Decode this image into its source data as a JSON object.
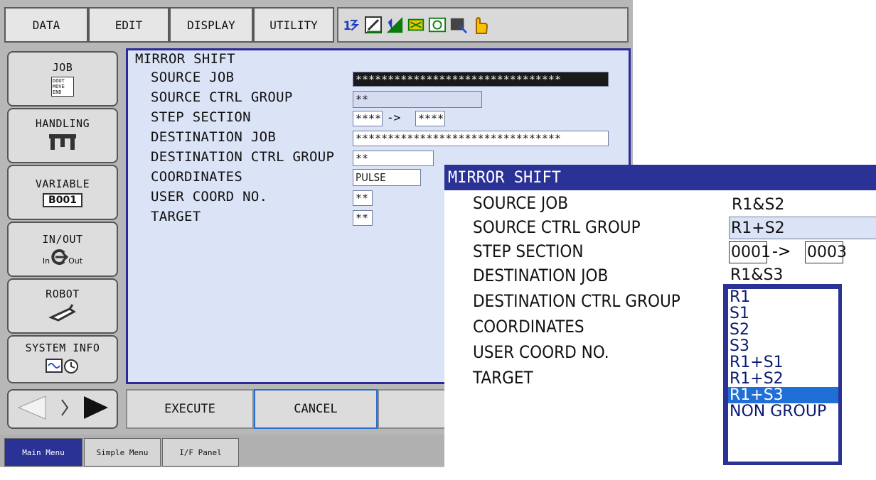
{
  "menu_bar": {
    "data": "DATA",
    "edit": "EDIT",
    "display": "DISPLAY",
    "utility": "UTILITY"
  },
  "status_icons": [
    "step-icon",
    "edit-mode-icon",
    "signal-icon",
    "tool-icon",
    "camera-icon",
    "lock-icon",
    "hand-icon"
  ],
  "side_menu": {
    "job": "JOB",
    "job_icon_text": "DOUT MOVE END",
    "handling": "HANDLING",
    "variable": "VARIABLE",
    "variable_icon_text": "B001",
    "in_out": "IN/OUT",
    "io_in": "In",
    "io_out": "Out",
    "robot": "ROBOT",
    "system_info": "SYSTEM INFO"
  },
  "window": {
    "title": "MIRROR SHIFT",
    "rows": [
      {
        "label": "SOURCE JOB",
        "value": "********************************"
      },
      {
        "label": "SOURCE CTRL GROUP",
        "value": "**"
      },
      {
        "label": "STEP SECTION",
        "from": "****",
        "arrow": "->",
        "to": "****"
      },
      {
        "label": "DESTINATION JOB",
        "value": "********************************"
      },
      {
        "label": "DESTINATION CTRL GROUP",
        "value": "**"
      },
      {
        "label": "COORDINATES",
        "value": "PULSE"
      },
      {
        "label": "USER COORD NO.",
        "value": "**"
      },
      {
        "label": "TARGET",
        "value": "**"
      }
    ]
  },
  "softkeys": {
    "execute": "EXECUTE",
    "cancel": "CANCEL"
  },
  "bottom_tabs": {
    "main": "Main Menu",
    "simple": "Simple Menu",
    "if_panel": "I/F Panel"
  },
  "zoom": {
    "title": "MIRROR SHIFT",
    "rows": [
      {
        "label": "SOURCE JOB",
        "value": "R1&S2"
      },
      {
        "label": "SOURCE CTRL GROUP",
        "value": "R1+S2"
      },
      {
        "label": "STEP SECTION",
        "from": "0001",
        "arrow": "->",
        "to": "0003"
      },
      {
        "label": "DESTINATION JOB",
        "value": "R1&S3"
      },
      {
        "label": "DESTINATION CTRL GROUP"
      },
      {
        "label": "COORDINATES"
      },
      {
        "label": "USER COORD NO."
      },
      {
        "label": "TARGET"
      }
    ],
    "dropdown_options": [
      "R1",
      "S1",
      "S2",
      "S3",
      "R1+S1",
      "R1+S2",
      "R1+S3",
      "NON GROUP"
    ],
    "dropdown_selected": "R1+S3"
  },
  "colors": {
    "title_bar": "#2a3295",
    "window_bg": "#dbe3f6",
    "selection": "#1f6fd6",
    "tab_active": "#2a3295"
  }
}
